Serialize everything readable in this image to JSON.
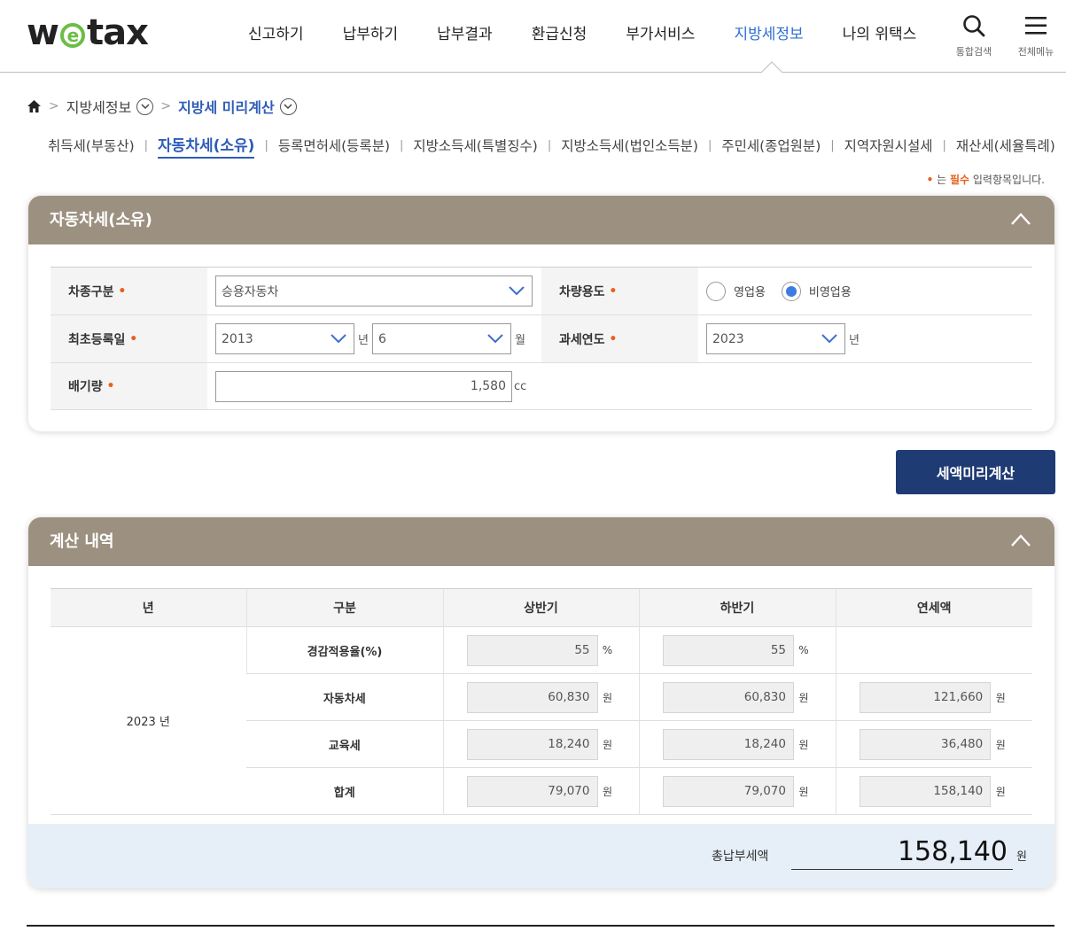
{
  "header": {
    "logo_prefix": "w",
    "logo_mark": "e",
    "logo_suffix": "tax",
    "nav": [
      "신고하기",
      "납부하기",
      "납부결과",
      "환급신청",
      "부가서비스",
      "지방세정보",
      "나의 위택스"
    ],
    "active_nav": "지방세정보",
    "search_label": "통합검색",
    "menu_label": "전체메뉴",
    "search_icon": "search-icon",
    "menu_icon": "hamburger-icon"
  },
  "breadcrumb": {
    "home_icon": "home-icon",
    "level1": "지방세정보",
    "level2": "지방세 미리계산"
  },
  "subtabs": [
    "취득세(부동산)",
    "자동차세(소유)",
    "등록면허세(등록분)",
    "지방소득세(특별징수)",
    "지방소득세(법인소득분)",
    "주민세(종업원분)",
    "지역자원시설세",
    "재산세(세율특례)"
  ],
  "active_subtab": "자동차세(소유)",
  "required_note": {
    "dot": "•",
    "prefix": " 는 ",
    "strong": "필수",
    "suffix": " 입력항목입니다."
  },
  "form_panel": {
    "title": "자동차세(소유)",
    "vehicle_type_label": "차종구분",
    "vehicle_type_value": "승용자동차",
    "usage_label": "차량용도",
    "usage_options": [
      "영업용",
      "비영업용"
    ],
    "usage_selected": "비영업용",
    "first_reg_label": "최초등록일",
    "first_reg_year": "2013",
    "year_unit": "년",
    "first_reg_month": "6",
    "month_unit": "월",
    "tax_year_label": "과세연도",
    "tax_year_value": "2023",
    "tax_year_unit": "년",
    "displacement_label": "배기량",
    "displacement_value": "1,580",
    "displacement_unit": "cc"
  },
  "calc_button": "세액미리계산",
  "result_panel": {
    "title": "계산 내역",
    "columns": [
      "년",
      "구분",
      "상반기",
      "하반기",
      "연세액"
    ],
    "year_cell": "2023 년",
    "rows": [
      {
        "label": "경감적용율(%)",
        "first": "55",
        "first_unit": "%",
        "second": "55",
        "second_unit": "%",
        "annual": null,
        "annual_unit": null
      },
      {
        "label": "자동차세",
        "first": "60,830",
        "first_unit": "원",
        "second": "60,830",
        "second_unit": "원",
        "annual": "121,660",
        "annual_unit": "원"
      },
      {
        "label": "교육세",
        "first": "18,240",
        "first_unit": "원",
        "second": "18,240",
        "second_unit": "원",
        "annual": "36,480",
        "annual_unit": "원"
      },
      {
        "label": "합계",
        "first": "79,070",
        "first_unit": "원",
        "second": "79,070",
        "second_unit": "원",
        "annual": "158,140",
        "annual_unit": "원"
      }
    ],
    "total_label": "총납부세액",
    "total_value": "158,140",
    "total_unit": "원"
  },
  "colors": {
    "accent_blue": "#2e5cb8",
    "panel_head": "#9c9080",
    "button": "#1f3b73",
    "required": "#e8601c",
    "total_bg": "#e6eff8"
  }
}
